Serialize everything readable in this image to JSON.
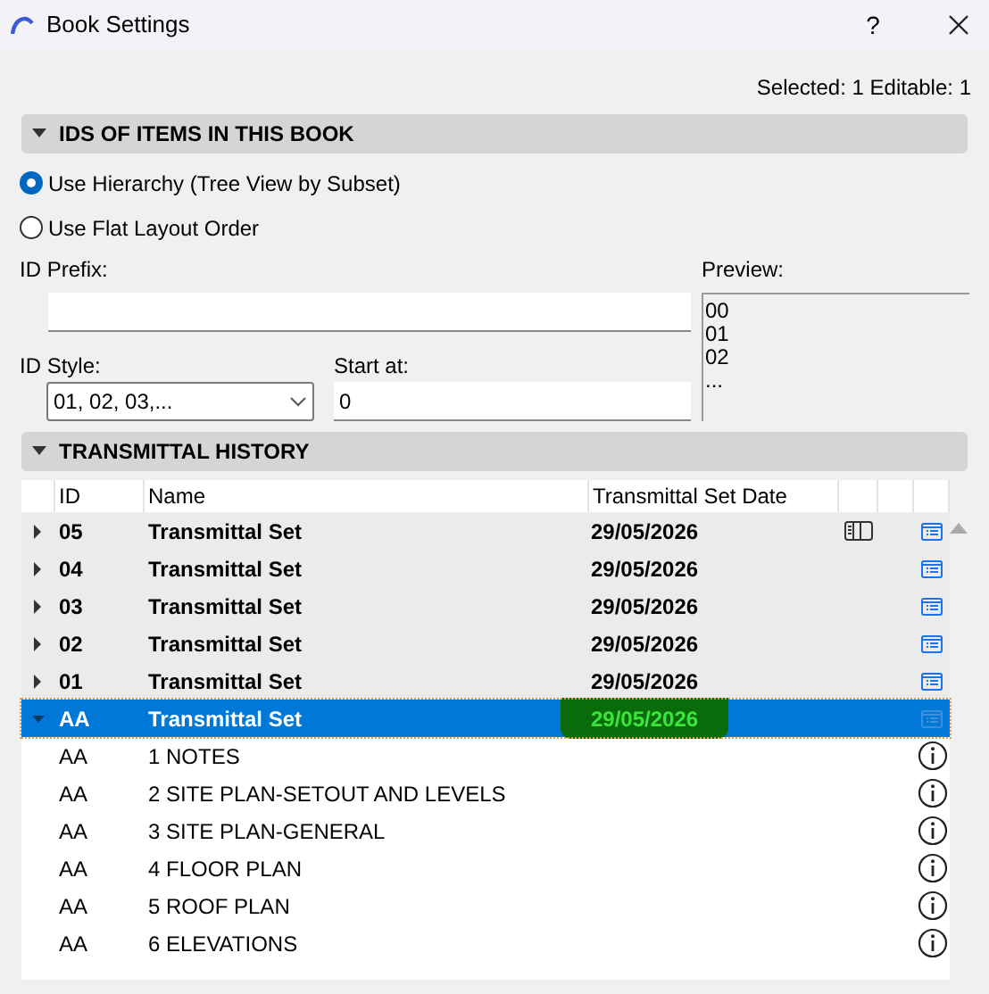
{
  "window": {
    "title": "Book Settings",
    "help": "?"
  },
  "status": "Selected: 1 Editable: 1",
  "ids_section": {
    "title": "IDS OF ITEMS IN THIS BOOK",
    "expanded": true,
    "radios": [
      {
        "label": "Use Hierarchy (Tree View by Subset)",
        "selected": true
      },
      {
        "label": "Use Flat Layout Order",
        "selected": false
      }
    ],
    "prefix_label": "ID Prefix:",
    "style_label": "ID Style:",
    "style_value": "01, 02, 03,...",
    "start_label": "Start at:",
    "start_value": "0",
    "preview_label": "Preview:",
    "preview_lines": [
      "00",
      "01",
      "02",
      "..."
    ]
  },
  "history_section": {
    "title": "TRANSMITTAL HISTORY",
    "expanded": true,
    "columns": [
      "ID",
      "Name",
      "Transmittal Set Date"
    ],
    "rows": [
      {
        "kind": "set",
        "id": "05",
        "name": "Transmittal Set",
        "date": "29/05/2026",
        "expanded": false,
        "selected": false,
        "highlighted": false,
        "marker": true
      },
      {
        "kind": "set",
        "id": "04",
        "name": "Transmittal Set",
        "date": "29/05/2026",
        "expanded": false,
        "selected": false,
        "highlighted": false,
        "marker": false
      },
      {
        "kind": "set",
        "id": "03",
        "name": "Transmittal Set",
        "date": "29/05/2026",
        "expanded": false,
        "selected": false,
        "highlighted": false,
        "marker": false
      },
      {
        "kind": "set",
        "id": "02",
        "name": "Transmittal Set",
        "date": "29/05/2026",
        "expanded": false,
        "selected": false,
        "highlighted": false,
        "marker": false
      },
      {
        "kind": "set",
        "id": "01",
        "name": "Transmittal Set",
        "date": "29/05/2026",
        "expanded": false,
        "selected": false,
        "highlighted": false,
        "marker": false
      },
      {
        "kind": "set",
        "id": "AA",
        "name": "Transmittal Set",
        "date": "29/05/2026",
        "expanded": true,
        "selected": true,
        "highlighted": true,
        "marker": false,
        "children": [
          {
            "kind": "layout",
            "id": "AA",
            "name": "1 NOTES"
          },
          {
            "kind": "layout",
            "id": "AA",
            "name": "2 SITE PLAN-SETOUT AND LEVELS"
          },
          {
            "kind": "layout",
            "id": "AA",
            "name": "3 SITE PLAN-GENERAL"
          },
          {
            "kind": "layout",
            "id": "AA",
            "name": "4 FLOOR PLAN"
          },
          {
            "kind": "layout",
            "id": "AA",
            "name": "5 ROOF PLAN"
          },
          {
            "kind": "layout",
            "id": "AA",
            "name": "6 ELEVATIONS"
          }
        ]
      }
    ]
  }
}
